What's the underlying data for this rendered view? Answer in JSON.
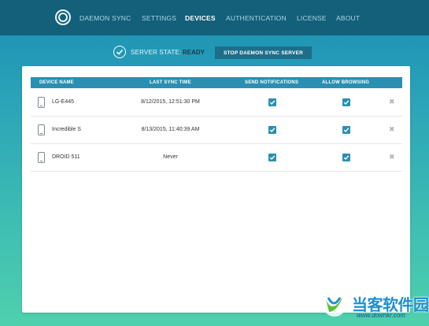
{
  "nav": {
    "items": [
      {
        "label": "DAEMON SYNC",
        "active": false
      },
      {
        "label": "SETTINGS",
        "active": false
      },
      {
        "label": "DEVICES",
        "active": true
      },
      {
        "label": "AUTHENTICATION",
        "active": false
      },
      {
        "label": "LICENSE",
        "active": false
      },
      {
        "label": "ABOUT",
        "active": false
      }
    ]
  },
  "status": {
    "label": "SERVER STATE:",
    "value": "READY",
    "stop_button": "STOP DAEMON SYNC SERVER"
  },
  "table": {
    "headers": {
      "device_name": "DEVICE NAME",
      "last_sync": "LAST SYNC TIME",
      "notifications": "SEND NOTIFICATIONS",
      "browsing": "ALLOW BROWSING"
    },
    "rows": [
      {
        "name": "LG-E445",
        "last_sync": "8/12/2015, 12:51:30 PM",
        "notifications": true,
        "browsing": true
      },
      {
        "name": "Incredible S",
        "last_sync": "8/13/2015, 11:40:39 AM",
        "notifications": true,
        "browsing": true
      },
      {
        "name": "DROID 511",
        "last_sync": "Never",
        "notifications": true,
        "browsing": true
      }
    ]
  },
  "watermark": {
    "text": "当客软件园",
    "url": "www.downkr.com"
  },
  "colors": {
    "nav_bg": "#145f7a",
    "accent": "#2a8fb0",
    "button": "#1d6e8a"
  }
}
